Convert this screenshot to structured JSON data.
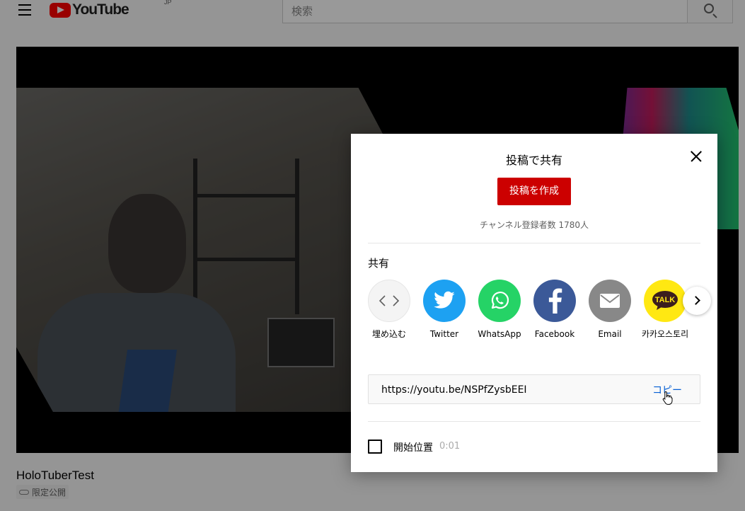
{
  "header": {
    "logo_text": "YouTube",
    "logo_region": "JP",
    "search_placeholder": "検索"
  },
  "video": {
    "title": "HoloTuberTest",
    "visibility": "限定公開"
  },
  "share_dialog": {
    "title": "投稿で共有",
    "create_post_label": "投稿を作成",
    "subscriber_text": "チャンネル登録者数 1780人",
    "section_label": "共有",
    "targets": [
      {
        "label": "埋め込む",
        "icon": "embed-icon",
        "color": "#f4f4f4"
      },
      {
        "label": "Twitter",
        "icon": "twitter-icon",
        "color": "#1da1f2"
      },
      {
        "label": "WhatsApp",
        "icon": "whatsapp-icon",
        "color": "#25d366"
      },
      {
        "label": "Facebook",
        "icon": "facebook-icon",
        "color": "#3b5998"
      },
      {
        "label": "Email",
        "icon": "email-icon",
        "color": "#888888"
      },
      {
        "label": "카카오스토리",
        "icon": "kakaotalk-icon",
        "color": "#ffe812"
      }
    ],
    "url": "https://youtu.be/NSPfZysbEEI",
    "copy_label": "コピー",
    "start_at_label": "開始位置",
    "start_at_time": "0:01",
    "start_at_checked": false
  }
}
